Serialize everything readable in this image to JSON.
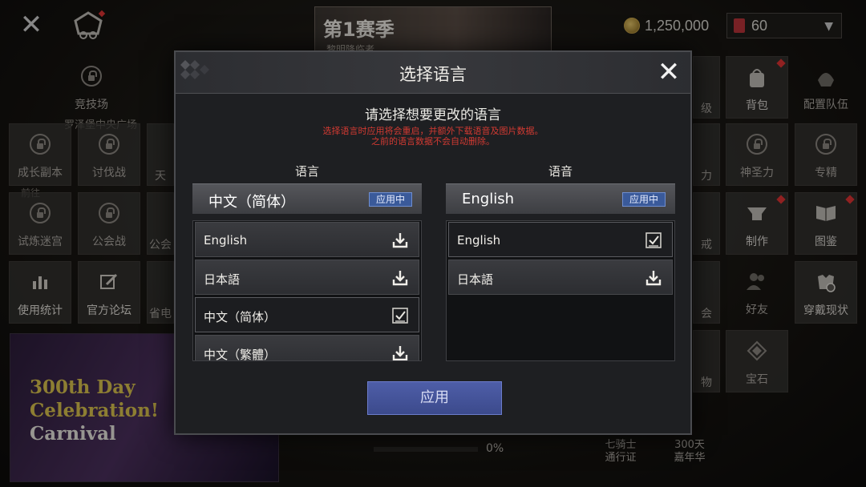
{
  "top_bar": {
    "season_title": "第1赛季",
    "season_sub": "黎明降临者",
    "gold": "1,250,000",
    "gems": "60"
  },
  "background_tiles": [
    {
      "label": "竞技场",
      "icon": "lock-icon"
    },
    {
      "label": "成长副本",
      "icon": "lock-icon"
    },
    {
      "label": "讨伐战",
      "icon": "lock-icon"
    },
    {
      "label": "天",
      "icon": "lock-icon"
    },
    {
      "label": "试炼迷宫",
      "icon": "lock-icon"
    },
    {
      "label": "公会战",
      "icon": "lock-icon"
    },
    {
      "label": "公会",
      "icon": "lock-icon"
    },
    {
      "label": "使用统计",
      "icon": "bar-chart-icon"
    },
    {
      "label": "官方论坛",
      "icon": "edit-icon"
    },
    {
      "label": "省电",
      "icon": "lock-icon"
    },
    {
      "label": "背包",
      "icon": "bag-icon"
    },
    {
      "label": "配置队伍",
      "icon": "helmet-icon"
    },
    {
      "label": "神圣力",
      "icon": "lock-icon"
    },
    {
      "label": "专精",
      "icon": "lock-icon"
    },
    {
      "label": "制作",
      "icon": "anvil-icon"
    },
    {
      "label": "图鉴",
      "icon": "book-icon"
    },
    {
      "label": "好友",
      "icon": "friends-icon"
    },
    {
      "label": "穿戴现状",
      "icon": "armor-icon"
    },
    {
      "label": "宝石",
      "icon": "gem-icon"
    }
  ],
  "bg_extra_text": {
    "square": "罗泽堡中央广场",
    "move": "前往",
    "suffix1": "级",
    "suffix2": "力",
    "suffix3": "戒",
    "suffix4": "会",
    "suffix5": "物"
  },
  "banner": {
    "line1": "300th Day",
    "line2": "Celebration!",
    "line3": "Carnival"
  },
  "progress": {
    "percent": "0%"
  },
  "bottom": {
    "knights_1": "七骑士",
    "knights_2": "通行证",
    "carnival_1": "300天",
    "carnival_2": "嘉年华"
  },
  "modal": {
    "title": "选择语言",
    "prompt": "请选择想要更改的语言",
    "warning_line1": "选择语言时应用将会重启，并额外下载语音及图片数据。",
    "warning_line2": "之前的语言数据不会自动删除。",
    "apply_label": "应用",
    "text_column": {
      "label": "语言",
      "current": "中文（简体）",
      "badge": "应用中",
      "items": [
        {
          "text": "English",
          "icon": "download-icon"
        },
        {
          "text": "日本語",
          "icon": "download-icon"
        },
        {
          "text": "中文（简体）",
          "icon": "checkbox-checked-icon",
          "selected": true
        },
        {
          "text": "中文（繁體）",
          "icon": "download-icon"
        }
      ]
    },
    "voice_column": {
      "label": "语音",
      "current": "English",
      "badge": "应用中",
      "items": [
        {
          "text": "English",
          "icon": "checkbox-checked-icon",
          "selected": true
        },
        {
          "text": "日本語",
          "icon": "download-icon"
        }
      ]
    }
  },
  "colors": {
    "accent_blue": "#3a5a9a",
    "warning_red": "#d23a32",
    "gold_text": "#d9c24e"
  }
}
